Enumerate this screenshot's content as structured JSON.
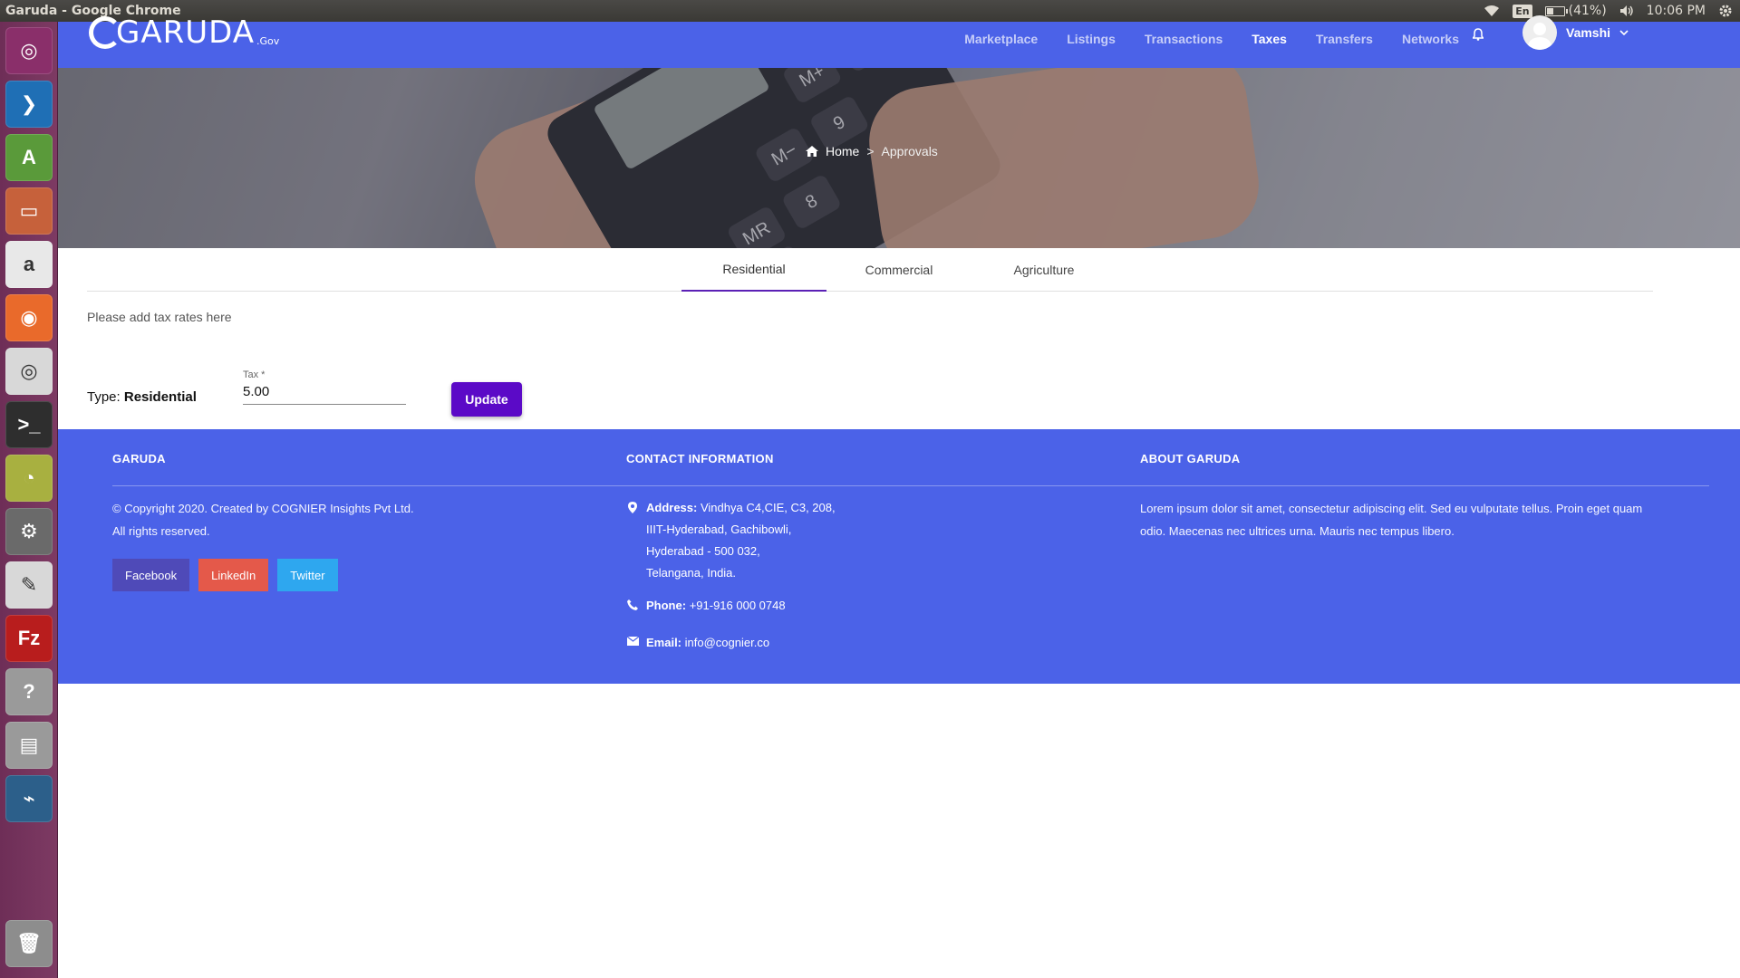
{
  "os": {
    "window_title": "Garuda - Google Chrome",
    "keyboard": "En",
    "battery": "(41%)",
    "battery_level": 0.41,
    "clock": "10:06 PM"
  },
  "launcher": {
    "items": [
      {
        "name": "ubuntu-dash",
        "color": "#8a2f6a"
      },
      {
        "name": "vscode",
        "color": "#1f6fb5"
      },
      {
        "name": "android-studio",
        "color": "#5a9a3a"
      },
      {
        "name": "files",
        "color": "#c6613b"
      },
      {
        "name": "amazon",
        "color": "#e8e8e8"
      },
      {
        "name": "firefox",
        "color": "#e96a2b"
      },
      {
        "name": "chrome",
        "color": "#d8d8d8"
      },
      {
        "name": "terminal",
        "color": "#2e2e2e"
      },
      {
        "name": "image-viewer",
        "color": "#a8b040"
      },
      {
        "name": "system-settings",
        "color": "#6a6a6a"
      },
      {
        "name": "text-editor",
        "color": "#d8d8d8"
      },
      {
        "name": "filezilla",
        "color": "#b81d1d"
      },
      {
        "name": "help",
        "color": "#9a9a9a"
      },
      {
        "name": "scanner",
        "color": "#9a9a9a"
      },
      {
        "name": "mysql-workbench",
        "color": "#2c5f8a"
      }
    ],
    "trash": "trash"
  },
  "nav": {
    "brand": "GARUDA",
    "brand_suffix": ".Gov",
    "links": [
      "Marketplace",
      "Listings",
      "Transactions",
      "Taxes",
      "Transfers",
      "Networks"
    ],
    "active": "Taxes",
    "user": "Vamshi"
  },
  "breadcrumb": {
    "home": "Home",
    "separator": ">",
    "current": "Approvals"
  },
  "tabs": [
    "Residential",
    "Commercial",
    "Agriculture"
  ],
  "active_tab": "Residential",
  "hint": "Please add tax rates here",
  "form": {
    "type_label": "Type:",
    "type_value": "Residential",
    "tax_label": "Tax *",
    "tax_value": "5.00",
    "update_label": "Update"
  },
  "footer": {
    "col1": {
      "heading": "GARUDA",
      "line1": "© Copyright 2020. Created by COGNIER Insights Pvt Ltd.",
      "line2": "All rights reserved.",
      "social": [
        {
          "label": "Facebook",
          "color": "#4f4ab8"
        },
        {
          "label": "LinkedIn",
          "color": "#e4594a"
        },
        {
          "label": "Twitter",
          "color": "#2ea7ef"
        }
      ]
    },
    "col2": {
      "heading": "CONTACT INFORMATION",
      "address_label": "Address:",
      "address_lines": [
        "Vindhya C4,CIE, C3, 208,",
        "IIIT-Hyderabad, Gachibowli,",
        "Hyderabad - 500 032,",
        "Telangana, India."
      ],
      "phone_label": "Phone:",
      "phone": "+91-916 000 0748",
      "email_label": "Email:",
      "email": "info@cognier.co"
    },
    "col3": {
      "heading": "ABOUT GARUDA",
      "text": "Lorem ipsum dolor sit amet, consectetur adipiscing elit. Sed eu vulputate tellus. Proin eget quam odio. Maecenas nec ultrices urna. Mauris nec tempus libero."
    }
  }
}
